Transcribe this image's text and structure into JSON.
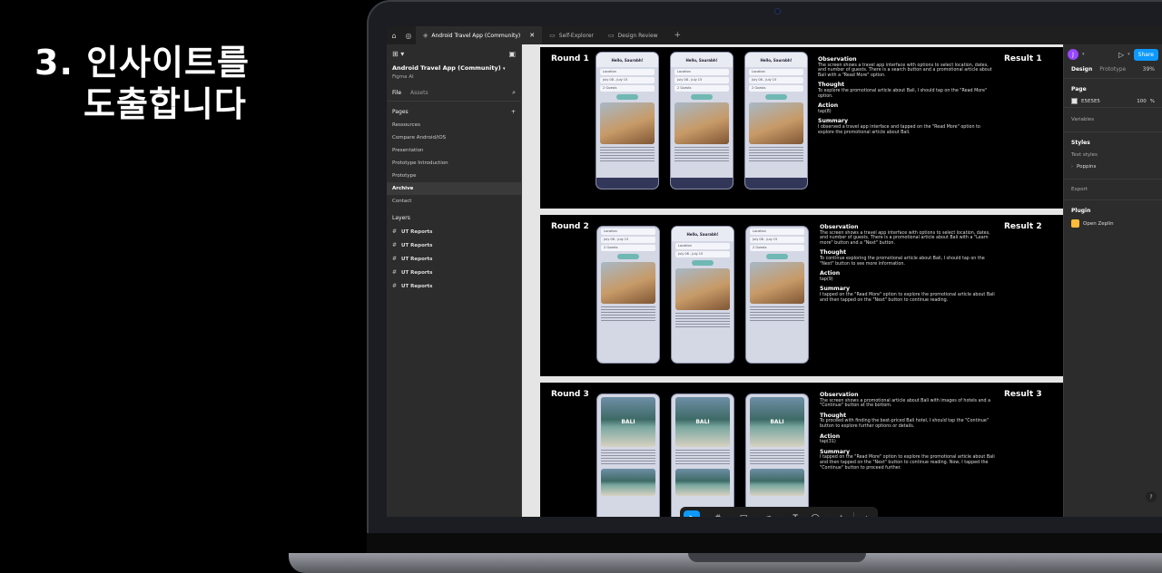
{
  "headline": {
    "line1": "3. 인사이트를",
    "line2": "도출합니다"
  },
  "tabs": [
    {
      "label": "Android Travel App (Community)",
      "active": true
    },
    {
      "label": "Self-Explorer",
      "active": false
    },
    {
      "label": "Design Review",
      "active": false
    }
  ],
  "left_panel": {
    "project_name": "Android Travel App (Community)",
    "team": "Figma AI",
    "file_tab": "File",
    "assets_tab": "Assets",
    "pages_header": "Pages",
    "pages": [
      "Ressources",
      "Compare Android/iOS",
      "Presentation",
      "Prototype Introduction",
      "Prototype",
      "Archive",
      "Contact"
    ],
    "selected_page": "Archive",
    "layers_header": "Layers",
    "layers": [
      "UT Reports",
      "UT Reports",
      "UT Reports",
      "UT Reports",
      "UT Reports"
    ]
  },
  "rounds": [
    {
      "title": "Round 1",
      "result": "Result 1",
      "observation": "The screen shows a travel app interface with options to select location, dates, and number of guests. There is a search button and a promotional article about Bali with a \"Read More\" option.",
      "thought": "To explore the promotional article about Bali, I should tap on the \"Read More\" option.",
      "action": "tap(8)",
      "summary": "I observed a travel app interface and tapped on the \"Read More\" option to explore the promotional article about Bali."
    },
    {
      "title": "Round 2",
      "result": "Result 2",
      "observation": "The screen shows a travel app interface with options to select location, dates, and number of guests. There is a promotional article about Bali with a \"Learn more\" button and a \"Next\" button.",
      "thought": "To continue exploring the promotional article about Bali, I should tap on the \"Next\" button to see more information.",
      "action": "tap(9)",
      "summary": "I tapped on the \"Read More\" option to explore the promotional article about Bali and then tapped on the \"Next\" button to continue reading."
    },
    {
      "title": "Round 3",
      "result": "Result 3",
      "observation": "The screen shows a promotional article about Bali with images of hotels and a \"Continue\" button at the bottom.",
      "thought": "To proceed with finding the best-priced Bali hotel, I should tap the \"Continue\" button to explore further options or details.",
      "action": "tap(31)",
      "summary": "I tapped on the \"Read More\" option to explore the promotional article about Bali and then tapped on the \"Next\" button to continue reading. Now, I tapped the \"Continue\" button to proceed further."
    }
  ],
  "labels": {
    "observation": "Observation",
    "thought": "Thought",
    "action": "Action",
    "summary": "Summary"
  },
  "phone": {
    "greeting": "Hello, Saurabh!",
    "location": "Location",
    "dates": "July 08 - July 15",
    "guests": "2 Guests",
    "bali": "BALI"
  },
  "right_panel": {
    "avatar_initial": "J",
    "share": "Share",
    "design_tab": "Design",
    "prototype_tab": "Prototype",
    "zoom": "39%",
    "page_section": "Page",
    "page_color": "E5E5E5",
    "page_opacity": "100",
    "percent": "%",
    "variables": "Variables",
    "styles": "Styles",
    "text_styles": "Text styles",
    "font": "Poppins",
    "export": "Export",
    "plugin": "Plugin",
    "plugin_name": "Open Zeplin",
    "help": "?"
  },
  "colors": {
    "accent": "#0d99ff",
    "canvas": "#e5e5e5",
    "panel": "#2c2c2c"
  }
}
